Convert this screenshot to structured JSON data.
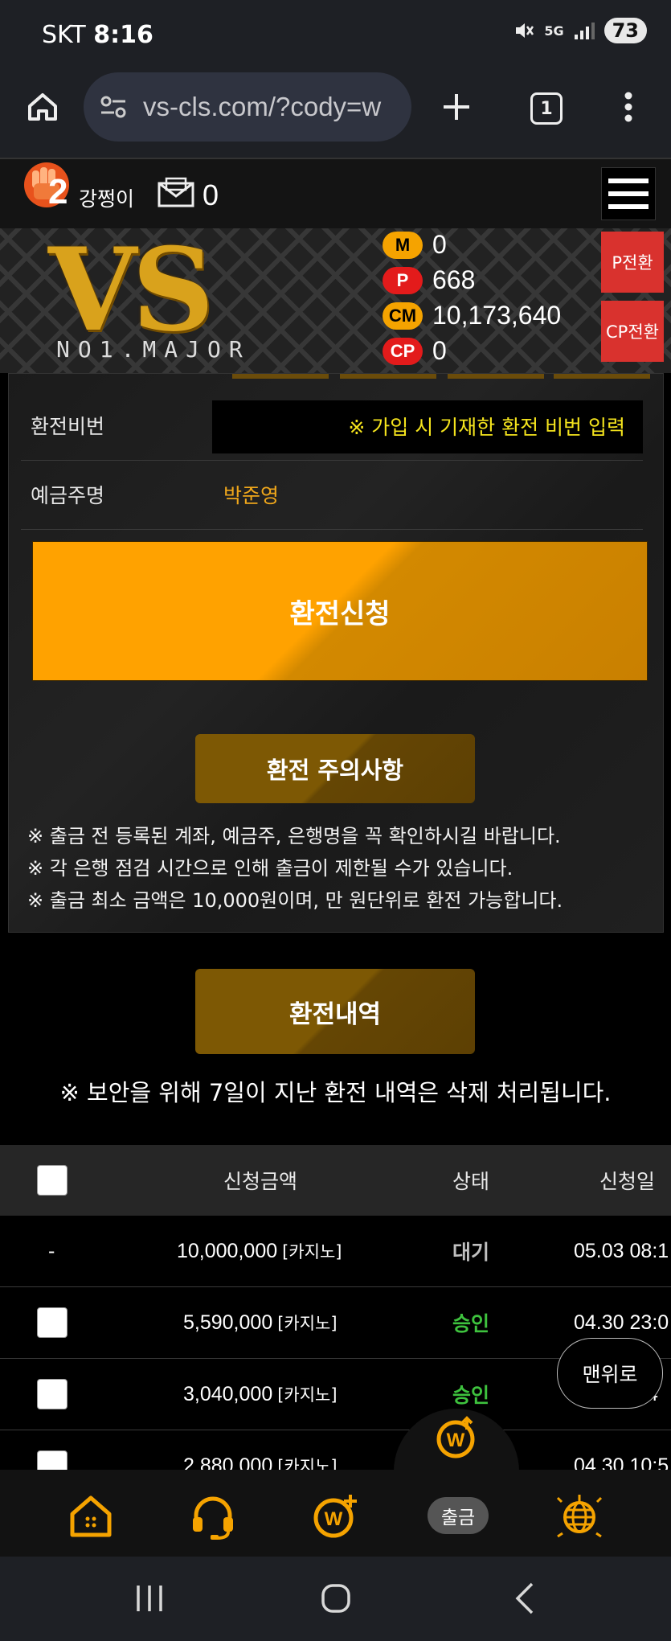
{
  "status_bar": {
    "carrier": "SKT",
    "time": "8:16",
    "network": "5G",
    "battery": "73"
  },
  "browser": {
    "url": "vs-cls.com/?cody=w",
    "tab_count": "1"
  },
  "header": {
    "level": "2",
    "nickname": "강쩡이",
    "mail_count": "0"
  },
  "banner": {
    "logo": "VS",
    "logo_sub": "NO1.MAJOR",
    "points": [
      {
        "badge": "M",
        "value": "0",
        "badge_bg": "#f5a300",
        "badge_fg": "#000"
      },
      {
        "badge": "P",
        "value": "668",
        "badge_bg": "#e31b1b",
        "badge_fg": "#fff"
      },
      {
        "badge": "CM",
        "value": "10,173,640",
        "badge_bg": "#f5a300",
        "badge_fg": "#000"
      },
      {
        "badge": "CP",
        "value": "0",
        "badge_bg": "#e31b1b",
        "badge_fg": "#fff"
      }
    ],
    "p_convert": "P전환",
    "cp_convert": "CP전환"
  },
  "form": {
    "pin_label": "환전비번",
    "pin_placeholder": "※ 가입 시 기재한 환전 비번 입력",
    "holder_label": "예금주명",
    "holder_value": "박준영",
    "apply_button": "환전신청"
  },
  "notice": {
    "button": "환전 주의사항",
    "lines": [
      "※ 출금 전 등록된 계좌, 예금주, 은행명을 꼭 확인하시길 바랍니다.",
      "※ 각 은행 점검 시간으로 인해 출금이 제한될 수가 있습니다.",
      "※ 출금 최소 금액은 10,000원이며, 만 원단위로 환전 가능합니다."
    ]
  },
  "history": {
    "button": "환전내역",
    "security_note": "※ 보안을 위해 7일이 지난 환전 내역은 삭제 처리됩니다.",
    "columns": [
      "신청금액",
      "상태",
      "신청일"
    ],
    "rows": [
      {
        "select": "-",
        "amount": "10,000,000",
        "type": "[카지노]",
        "status": "대기",
        "date": "05.03 08:1"
      },
      {
        "select": "",
        "amount": "5,590,000",
        "type": "[카지노]",
        "status": "승인",
        "date": "04.30 23:0"
      },
      {
        "select": "",
        "amount": "3,040,000",
        "type": "[카지노]",
        "status": "승인",
        "date": ":4"
      },
      {
        "select": "",
        "amount": "2,880,000",
        "type": "[카지노]",
        "status": "",
        "date": "04.30 10:5"
      }
    ]
  },
  "top_button": "맨위로",
  "bottom_nav": {
    "withdraw_label": "출금",
    "accent": "#f5a300"
  }
}
